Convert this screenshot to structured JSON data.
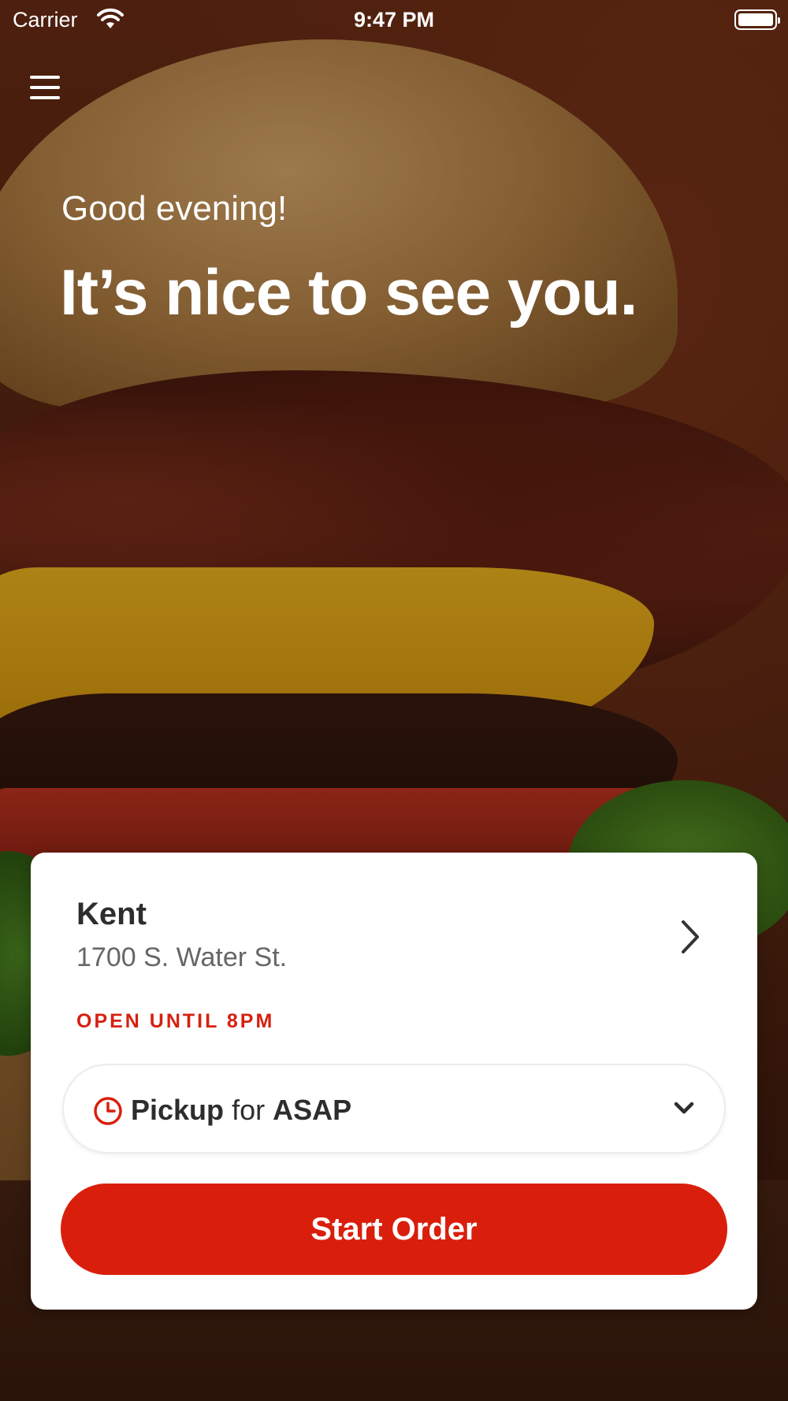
{
  "status_bar": {
    "carrier": "Carrier",
    "time": "9:47 PM",
    "wifi_icon": "wifi-icon",
    "battery_icon": "battery-icon"
  },
  "header": {
    "menu_icon": "hamburger-menu-icon"
  },
  "greeting": {
    "subtitle": "Good evening!",
    "headline": "It’s nice to see you."
  },
  "location_card": {
    "store_name": "Kent",
    "address": "1700 S. Water St.",
    "hours": "OPEN UNTIL 8PM",
    "chevron_icon": "chevron-right-icon",
    "order_type": {
      "method": "Pickup",
      "connector": "for",
      "time": "ASAP",
      "clock_icon": "clock-icon",
      "dropdown_icon": "chevron-down-icon"
    },
    "start_order_label": "Start Order"
  },
  "colors": {
    "accent": "#d91f0c",
    "text_dark": "#2d2d2d",
    "text_muted": "#666666",
    "card_bg": "#ffffff"
  }
}
